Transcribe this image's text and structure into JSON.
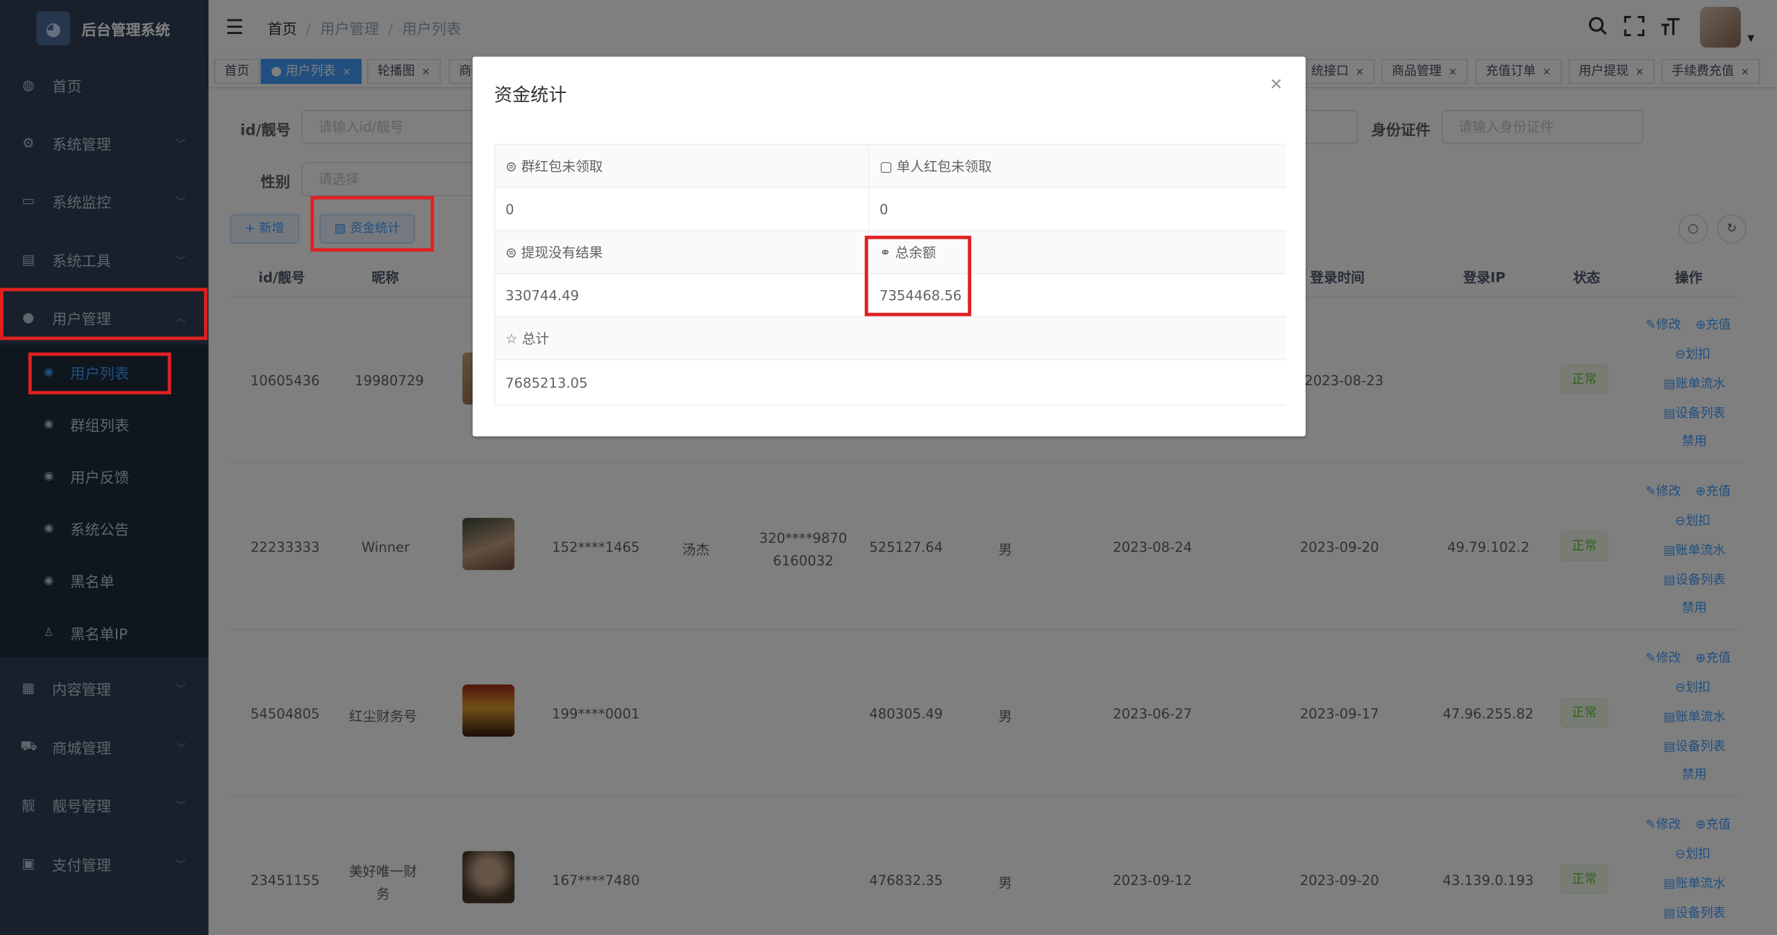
{
  "app": {
    "title": "后台管理系统"
  },
  "sidebar": {
    "items": [
      {
        "label": "首页",
        "icon": "dashboard-icon"
      },
      {
        "label": "系统管理",
        "icon": "gear-icon"
      },
      {
        "label": "系统监控",
        "icon": "monitor-icon"
      },
      {
        "label": "系统工具",
        "icon": "toolbox-icon"
      },
      {
        "label": "用户管理",
        "icon": "user-icon"
      },
      {
        "label": "内容管理",
        "icon": "document-icon"
      },
      {
        "label": "商城管理",
        "icon": "cart-icon"
      },
      {
        "label": "靓号管理",
        "icon": "tag-icon"
      },
      {
        "label": "支付管理",
        "icon": "wallet-icon"
      }
    ],
    "sub_items": [
      "用户列表",
      "群组列表",
      "用户反馈",
      "系统公告",
      "黑名单",
      "黑名单IP"
    ]
  },
  "breadcrumb": [
    "首页",
    "用户管理",
    "用户列表"
  ],
  "tags": [
    {
      "label": "首页"
    },
    {
      "label": "用户列表"
    },
    {
      "label": "轮播图"
    },
    {
      "label": "商"
    },
    {
      "label": "统接口"
    },
    {
      "label": "商品管理"
    },
    {
      "label": "充值订单"
    },
    {
      "label": "用户提现"
    },
    {
      "label": "手续费充值"
    }
  ],
  "filters": {
    "id_label": "id/靓号",
    "id_placeholder": "请输入id/靓号",
    "gender_label": "性别",
    "gender_placeholder": "请选择",
    "idcard_label": "身份证件",
    "idcard_placeholder": "请输入身份证件"
  },
  "toolbar": {
    "add_label": "+ 新增",
    "stats_label": "资金统计"
  },
  "table": {
    "headers": {
      "id": "id/靓号",
      "nickname": "昵称",
      "login_time": "登录时间",
      "login_ip": "登录IP",
      "status": "状态",
      "ops": "操作"
    },
    "rows": [
      {
        "id": "10605436",
        "nickname": "19980729",
        "phone": "",
        "name": "",
        "idcard": "",
        "balance": "",
        "gender": "",
        "reg": "",
        "login": "2023-08-23",
        "ip": "",
        "status": "正常"
      },
      {
        "id": "22233333",
        "nickname": "Winner",
        "phone": "152****1465",
        "name": "汤杰",
        "idcard": "320****9870\n6160032",
        "balance": "525127.64",
        "gender": "男",
        "reg": "2023-08-24",
        "login": "2023-09-20",
        "ip": "49.79.102.2",
        "status": "正常"
      },
      {
        "id": "54504805",
        "nickname": "红尘财务号",
        "phone": "199****0001",
        "name": "",
        "idcard": "",
        "balance": "480305.49",
        "gender": "男",
        "reg": "2023-06-27",
        "login": "2023-09-17",
        "ip": "47.96.255.82",
        "status": "正常"
      },
      {
        "id": "23451155",
        "nickname": "美好唯一财\n务",
        "phone": "167****7480",
        "name": "",
        "idcard": "",
        "balance": "476832.35",
        "gender": "男",
        "reg": "2023-09-12",
        "login": "2023-09-20",
        "ip": "43.139.0.193",
        "status": "正常"
      }
    ],
    "ops": {
      "edit": "修改",
      "recharge": "充值",
      "deduct": "划扣",
      "ledger": "账单流水",
      "devices": "设备列表",
      "ban": "禁用"
    }
  },
  "dialog": {
    "title": "资金统计",
    "fields": {
      "group_unclaimed": {
        "label": "群红包未领取",
        "value": "0"
      },
      "single_unclaimed": {
        "label": "单人红包未领取",
        "value": "0"
      },
      "withdraw_pending": {
        "label": "提现没有结果",
        "value": "330744.49"
      },
      "total_balance": {
        "label": "总余额",
        "value": "7354468.56"
      },
      "total": {
        "label": "总计",
        "value": "7685213.05"
      }
    }
  },
  "colors": {
    "sidebar_bg": "#304156",
    "accent": "#409eff",
    "highlight": "#e02020",
    "status_ok": "#67c23a"
  }
}
